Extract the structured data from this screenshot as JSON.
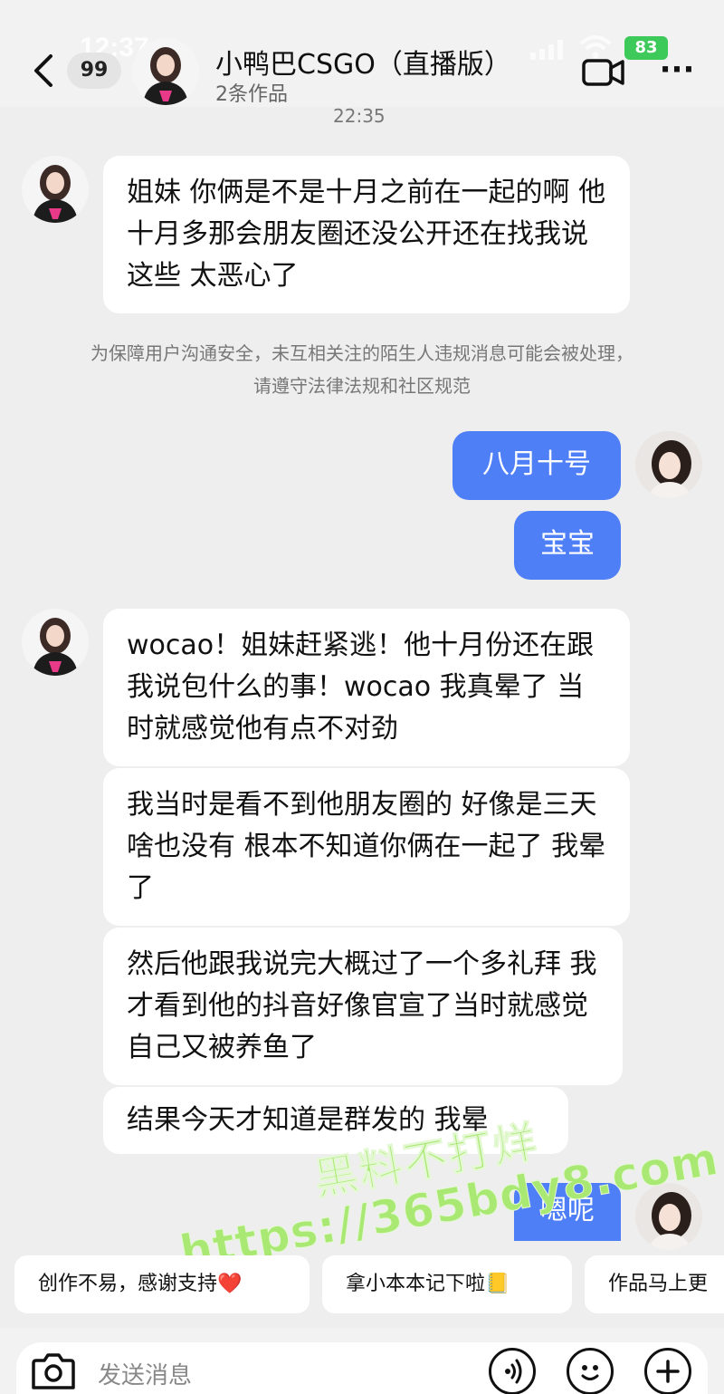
{
  "status": {
    "time": "12:37",
    "battery": "83"
  },
  "header": {
    "unread_count": "99",
    "title": "小鸭巴CSGO（直播版）",
    "subtitle": "2条作品"
  },
  "timestamp": "22:35",
  "notice": "为保障用户沟通安全，未互相关注的陌生人违规消息可能会被处理，请遵守法律法规和社区规范",
  "messages": {
    "m1": "姐妹  你俩是不是十月之前在一起的啊  他十月多那会朋友圈还没公开还在找我说这些  太恶心了",
    "m2": "八月十号",
    "m3": "宝宝",
    "m4": "wocao！姐妹赶紧逃！他十月份还在跟我说包什么的事！wocao  我真晕了  当时就感觉他有点不对劲",
    "m5": "我当时是看不到他朋友圈的  好像是三天  啥也没有 根本不知道你俩在一起了  我晕了",
    "m6": "然后他跟我说完大概过了一个多礼拜  我才看到他的抖音好像官宣了当时就感觉自己又被养鱼了",
    "m7": "结果今天才知道是群发的  我晕",
    "m8": "嗯呢"
  },
  "watermark": {
    "line1": "黑料不打烊",
    "line2": "https://365bdy8.com"
  },
  "quick_replies": [
    "创作不易，感谢支持❤️",
    "拿小本本记下啦📒",
    "作品马上更"
  ],
  "input": {
    "placeholder": "发送消息"
  },
  "colors": {
    "outgoing_bubble": "#4f7ff7",
    "incoming_bubble": "#ffffff",
    "background": "#eeeeee",
    "watermark": "#a8e873"
  },
  "icons": [
    "back-chevron-icon",
    "video-call-icon",
    "more-icon",
    "camera-icon",
    "voice-icon",
    "emoji-icon",
    "plus-icon"
  ]
}
